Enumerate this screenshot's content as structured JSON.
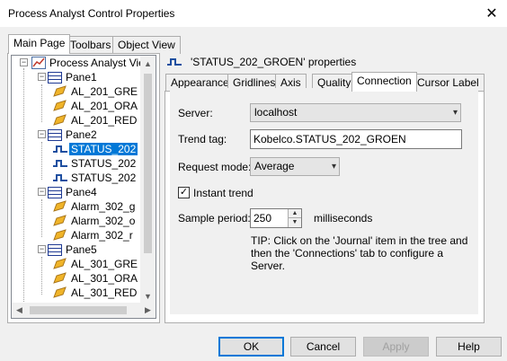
{
  "window": {
    "title": "Process Analyst Control Properties",
    "close_glyph": "✕"
  },
  "left_tabs": [
    {
      "label": "Main Page",
      "active": true
    },
    {
      "label": "Toolbars",
      "active": false
    },
    {
      "label": "Object View",
      "active": false
    }
  ],
  "tree": {
    "root": "Process Analyst View",
    "nodes": [
      {
        "label": "Pane1",
        "kind": "pane"
      },
      {
        "label": "AL_201_GRE",
        "kind": "alarm"
      },
      {
        "label": "AL_201_ORA",
        "kind": "alarm"
      },
      {
        "label": "AL_201_RED",
        "kind": "alarm"
      },
      {
        "label": "Pane2",
        "kind": "pane"
      },
      {
        "label": "STATUS_202",
        "kind": "trend",
        "selected": true
      },
      {
        "label": "STATUS_202",
        "kind": "trend"
      },
      {
        "label": "STATUS_202",
        "kind": "trend"
      },
      {
        "label": "Pane4",
        "kind": "pane"
      },
      {
        "label": "Alarm_302_g",
        "kind": "alarm"
      },
      {
        "label": "Alarm_302_o",
        "kind": "alarm"
      },
      {
        "label": "Alarm_302_r",
        "kind": "alarm"
      },
      {
        "label": "Pane5",
        "kind": "pane"
      },
      {
        "label": "AL_301_GRE",
        "kind": "alarm"
      },
      {
        "label": "AL_301_ORA",
        "kind": "alarm"
      },
      {
        "label": "AL_301_RED",
        "kind": "alarm"
      }
    ]
  },
  "properties": {
    "header": "'STATUS_202_GROEN' properties",
    "tabs": [
      {
        "label": "Appearance",
        "active": false
      },
      {
        "label": "Gridlines",
        "active": false
      },
      {
        "label": "Axis",
        "active": false
      },
      {
        "label": "Quality",
        "active": false
      },
      {
        "label": "Connection",
        "active": true
      },
      {
        "label": "Cursor Label",
        "active": false
      }
    ],
    "connection": {
      "server_label": "Server:",
      "server_value": "localhost",
      "trend_tag_label": "Trend tag:",
      "trend_tag_value": "Kobelco.STATUS_202_GROEN",
      "request_mode_label": "Request mode:",
      "request_mode_value": "Average",
      "instant_trend_label": "Instant trend",
      "instant_trend_checked": true,
      "sample_period_label": "Sample period:",
      "sample_period_value": "250",
      "sample_period_unit": "milliseconds",
      "tip": "TIP: Click on the 'Journal' item in the tree and then the 'Connections' tab to configure a Server."
    }
  },
  "buttons": {
    "ok": "OK",
    "cancel": "Cancel",
    "apply": "Apply",
    "help": "Help"
  },
  "colors": {
    "selection": "#0078d7",
    "accent_border": "#0078d7",
    "pane_icon": "#1f3a93",
    "alarm_icon": "#e8a317",
    "trend_icon": "#1f4fa0"
  }
}
